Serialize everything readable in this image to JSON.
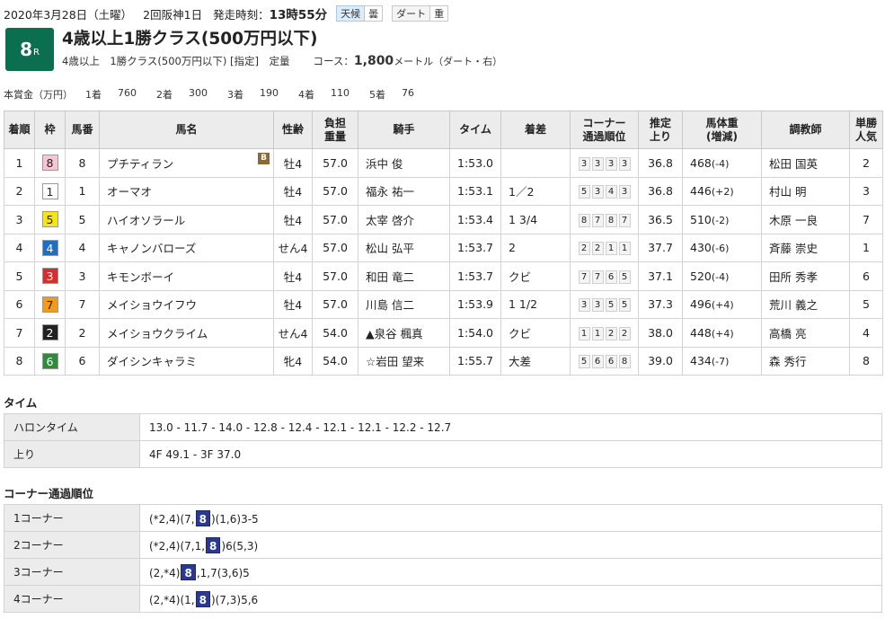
{
  "header": {
    "date": "2020年3月28日（土曜）",
    "meeting": "2回阪神1日",
    "post_time_label": "発走時刻：",
    "post_time": "13時55分",
    "weather_label": "天候",
    "weather": "曇",
    "track_label": "ダート",
    "track_condition": "重"
  },
  "race": {
    "number": "8",
    "number_suffix": "R",
    "title": "4歳以上1勝クラス(500万円以下)",
    "conditions": "4歳以上　1勝クラス(500万円以下) [指定]　定量",
    "course_label": "コース：",
    "distance": "1,800",
    "distance_unit": "メートル（ダート・右）"
  },
  "prize": {
    "label": "本賞金（万円）",
    "entries": [
      {
        "place": "1着",
        "amount": "760"
      },
      {
        "place": "2着",
        "amount": "300"
      },
      {
        "place": "3着",
        "amount": "190"
      },
      {
        "place": "4着",
        "amount": "110"
      },
      {
        "place": "5着",
        "amount": "76"
      }
    ]
  },
  "table": {
    "headers": {
      "rank": "着順",
      "waku": "枠",
      "umaban": "馬番",
      "horse": "馬名",
      "sex_age": "性齢",
      "weight_carried_1": "負担",
      "weight_carried_2": "重量",
      "jockey": "騎手",
      "time": "タイム",
      "margin": "着差",
      "corner_1": "コーナー",
      "corner_2": "通過順位",
      "last_1": "推定",
      "last_2": "上り",
      "body_weight_1": "馬体重",
      "body_weight_2": "(増減)",
      "trainer": "調教師",
      "pop_1": "単勝",
      "pop_2": "人気"
    },
    "rows": [
      {
        "rank": "1",
        "waku": "8",
        "umaban": "8",
        "horse": "プチティラン",
        "blinker": "B",
        "sex_age": "牡4",
        "weight": "57.0",
        "jockey": "浜中 俊",
        "time": "1:53.0",
        "margin": "",
        "corners": [
          "3",
          "3",
          "3",
          "3"
        ],
        "last3f": "36.8",
        "body_weight": "468",
        "body_diff": "(-4)",
        "trainer": "松田 国英",
        "popularity": "2"
      },
      {
        "rank": "2",
        "waku": "1",
        "umaban": "1",
        "horse": "オーマオ",
        "sex_age": "牡4",
        "weight": "57.0",
        "jockey": "福永 祐一",
        "time": "1:53.1",
        "margin": "1／2",
        "corners": [
          "5",
          "3",
          "4",
          "3"
        ],
        "last3f": "36.8",
        "body_weight": "446",
        "body_diff": "(+2)",
        "trainer": "村山 明",
        "popularity": "3"
      },
      {
        "rank": "3",
        "waku": "5",
        "umaban": "5",
        "horse": "ハイオソラール",
        "sex_age": "牡4",
        "weight": "57.0",
        "jockey": "太宰 啓介",
        "time": "1:53.4",
        "margin": "1 3/4",
        "corners": [
          "8",
          "7",
          "8",
          "7"
        ],
        "last3f": "36.5",
        "body_weight": "510",
        "body_diff": "(-2)",
        "trainer": "木原 一良",
        "popularity": "7"
      },
      {
        "rank": "4",
        "waku": "4",
        "umaban": "4",
        "horse": "キャノンバローズ",
        "sex_age": "せん4",
        "weight": "57.0",
        "jockey": "松山 弘平",
        "time": "1:53.7",
        "margin": "2",
        "corners": [
          "2",
          "2",
          "1",
          "1"
        ],
        "last3f": "37.7",
        "body_weight": "430",
        "body_diff": "(-6)",
        "trainer": "斉藤 崇史",
        "popularity": "1"
      },
      {
        "rank": "5",
        "waku": "3",
        "umaban": "3",
        "horse": "キモンボーイ",
        "sex_age": "牡4",
        "weight": "57.0",
        "jockey": "和田 竜二",
        "time": "1:53.7",
        "margin": "クビ",
        "corners": [
          "7",
          "7",
          "6",
          "5"
        ],
        "last3f": "37.1",
        "body_weight": "520",
        "body_diff": "(-4)",
        "trainer": "田所 秀孝",
        "popularity": "6"
      },
      {
        "rank": "6",
        "waku": "7",
        "umaban": "7",
        "horse": "メイショウイフウ",
        "sex_age": "牡4",
        "weight": "57.0",
        "jockey": "川島 信二",
        "time": "1:53.9",
        "margin": "1 1/2",
        "corners": [
          "3",
          "3",
          "5",
          "5"
        ],
        "last3f": "37.3",
        "body_weight": "496",
        "body_diff": "(+4)",
        "trainer": "荒川 義之",
        "popularity": "5"
      },
      {
        "rank": "7",
        "waku": "2",
        "umaban": "2",
        "horse": "メイショウクライム",
        "sex_age": "せん4",
        "weight": "54.0",
        "jockey": "▲泉谷 楓真",
        "time": "1:54.0",
        "margin": "クビ",
        "corners": [
          "1",
          "1",
          "2",
          "2"
        ],
        "last3f": "38.0",
        "body_weight": "448",
        "body_diff": "(+4)",
        "trainer": "高橋 亮",
        "popularity": "4"
      },
      {
        "rank": "8",
        "waku": "6",
        "umaban": "6",
        "horse": "ダイシンキャラミ",
        "sex_age": "牝4",
        "weight": "54.0",
        "jockey": "☆岩田 望来",
        "time": "1:55.7",
        "margin": "大差",
        "corners": [
          "5",
          "6",
          "6",
          "8"
        ],
        "last3f": "39.0",
        "body_weight": "434",
        "body_diff": "(-7)",
        "trainer": "森 秀行",
        "popularity": "8"
      }
    ]
  },
  "waku_colors": {
    "1": {
      "bg": "#ffffff",
      "fg": "#222222"
    },
    "2": {
      "bg": "#222222",
      "fg": "#ffffff"
    },
    "3": {
      "bg": "#d32f2f",
      "fg": "#ffffff"
    },
    "4": {
      "bg": "#1f6fc5",
      "fg": "#ffffff"
    },
    "5": {
      "bg": "#f6e31a",
      "fg": "#222222"
    },
    "6": {
      "bg": "#2f8a3a",
      "fg": "#ffffff"
    },
    "7": {
      "bg": "#f29a1d",
      "fg": "#222222"
    },
    "8": {
      "bg": "#f6c6d3",
      "fg": "#222222"
    }
  },
  "time_section": {
    "title": "タイム",
    "rows": [
      {
        "label": "ハロンタイム",
        "value": "13.0 - 11.7 - 14.0 - 12.8 - 12.4 - 12.1 - 12.1 - 12.2 - 12.7"
      },
      {
        "label": "上り",
        "value": "4F 49.1 - 3F 37.0"
      }
    ]
  },
  "corner_section": {
    "title": "コーナー通過順位",
    "highlight_color": "#2b3a8f",
    "rows": [
      {
        "label": "1コーナー",
        "before": "(*2,4)(7,",
        "highlight": "8",
        "after": ")(1,6)3-5"
      },
      {
        "label": "2コーナー",
        "before": "(*2,4)(7,1,",
        "highlight": "8",
        "after": ")6(5,3)"
      },
      {
        "label": "3コーナー",
        "before": "(2,*4)",
        "highlight": "8",
        "after": ",1,7(3,6)5"
      },
      {
        "label": "4コーナー",
        "before": "(2,*4)(1,",
        "highlight": "8",
        "after": ")(7,3)5,6"
      }
    ]
  }
}
